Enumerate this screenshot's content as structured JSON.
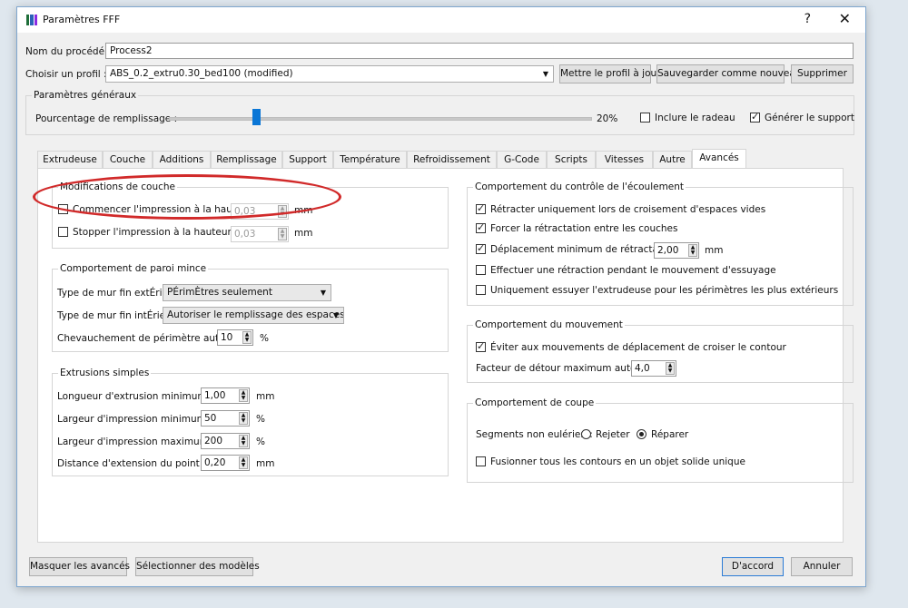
{
  "window": {
    "title": "Paramètres FFF",
    "help": "?",
    "close": "✕"
  },
  "top": {
    "process_label": "Nom du procédé :",
    "process_value": "Process2",
    "profile_label": "Choisir un profil :",
    "profile_value": "ABS_0.2_extru0.30_bed100 (modified)",
    "update_btn": "Mettre le profil à jour",
    "save_btn": "Sauvegarder comme nouveau",
    "delete_btn": "Supprimer"
  },
  "general": {
    "title": "Paramètres généraux",
    "fill_label": "Pourcentage de remplissage :",
    "fill_value": "20%",
    "fill_fraction": 0.2,
    "raft_label": "Inclure le radeau",
    "raft_checked": false,
    "support_label": "Générer le support",
    "support_checked": true
  },
  "tabs": [
    "Extrudeuse",
    "Couche",
    "Additions",
    "Remplissage",
    "Support",
    "Température",
    "Refroidissement",
    "G-Code",
    "Scripts",
    "Vitesses",
    "Autre",
    "Avancés"
  ],
  "active_tab": "Avancés",
  "layer_mod": {
    "title": "Modifications de couche",
    "start_label": "Commencer l'impression à la hauteur",
    "start_value": "0,03",
    "start_unit": "mm",
    "stop_label": "Stopper l'impression à la hauteur",
    "stop_value": "0,03",
    "stop_unit": "mm"
  },
  "thin_wall": {
    "title": "Comportement de paroi mince",
    "ext_label": "Type de mur fin extÉrieur",
    "ext_value": "PÉrimÈtres seulement",
    "int_label": "Type de mur fin intÉrieur",
    "int_value": "Autoriser le remplissage des espaces",
    "overlap_label": "Chevauchement de périmètre autorisé",
    "overlap_value": "10",
    "overlap_unit": "%"
  },
  "extrusions": {
    "title": "Extrusions simples",
    "rows": [
      {
        "label": "Longueur d'extrusion minimum",
        "value": "1,00",
        "unit": "mm"
      },
      {
        "label": "Largeur d'impression minimum",
        "value": "50",
        "unit": "%"
      },
      {
        "label": "Largeur d'impression maximum",
        "value": "200",
        "unit": "%"
      },
      {
        "label": "Distance d'extension du point final",
        "value": "0,20",
        "unit": "mm"
      }
    ]
  },
  "flow": {
    "title": "Comportement du contrôle de l'écoulement",
    "retract_label": "Rétracter uniquement lors de croisement d'espaces vides",
    "force_label": "Forcer la rétractation entre les couches",
    "min_label": "Déplacement minimum de rétractation",
    "min_value": "2,00",
    "min_unit": "mm",
    "wipe_label": "Effectuer une rétraction pendant le mouvement d'essuyage",
    "wipe_outer_label": "Uniquement essuyer l'extrudeuse pour les périmètres les plus extérieurs"
  },
  "movement": {
    "title": "Comportement du mouvement",
    "avoid_label": "Éviter aux mouvements de déplacement de croiser le contour",
    "detour_label": "Facteur de détour maximum autorisé",
    "detour_value": "4,0"
  },
  "cut": {
    "title": "Comportement de coupe",
    "segments_label": "Segments non eulérien :",
    "reject_label": "Rejeter",
    "repair_label": "Réparer",
    "merge_label": "Fusionner tous les contours en un objet solide unique"
  },
  "bottom": {
    "hide_adv": "Masquer les avancés",
    "select_models": "Sélectionner des modèles",
    "ok": "D'accord",
    "cancel": "Annuler"
  },
  "colors": {
    "accent": "#0a76d6",
    "annotation": "#d12a2a"
  }
}
